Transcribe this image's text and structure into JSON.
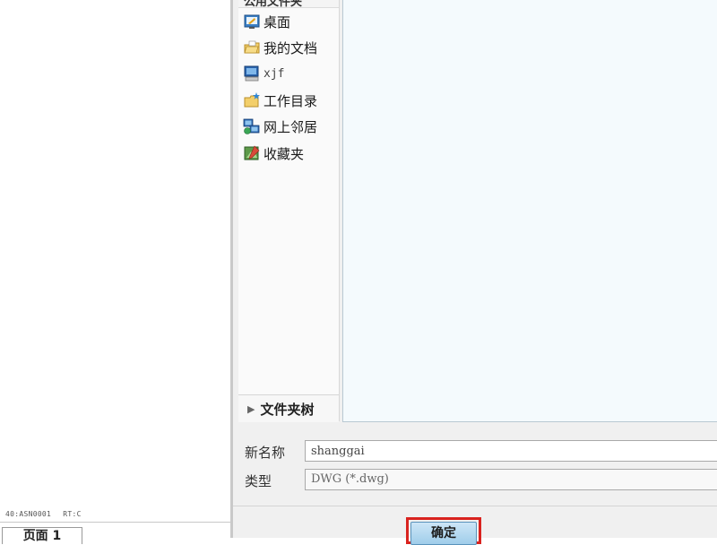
{
  "left_pane": {
    "status": [
      "40:ASN0001",
      "RT:C"
    ],
    "page_tab_label": "页面 1"
  },
  "dialog": {
    "places_header": "公用文件夹",
    "places": [
      {
        "label": "桌面",
        "icon": "desktop-icon"
      },
      {
        "label": "我的文档",
        "icon": "my-documents-icon"
      },
      {
        "label": "xjf",
        "icon": "computer-icon"
      },
      {
        "label": "工作目录",
        "icon": "working-directory-icon"
      },
      {
        "label": "网上邻居",
        "icon": "network-icon"
      },
      {
        "label": "收藏夹",
        "icon": "favorites-icon"
      }
    ],
    "folder_tree_label": "文件夹树",
    "fields": {
      "new_name_label": "新名称",
      "new_name_value": "shanggai",
      "type_label": "类型",
      "type_value": "DWG (*.dwg)"
    },
    "ok_label": "确定"
  },
  "colors": {
    "highlight": "#d9231f",
    "file_list_bg": "#f4fafd",
    "button_blue": "#9fcdea"
  }
}
